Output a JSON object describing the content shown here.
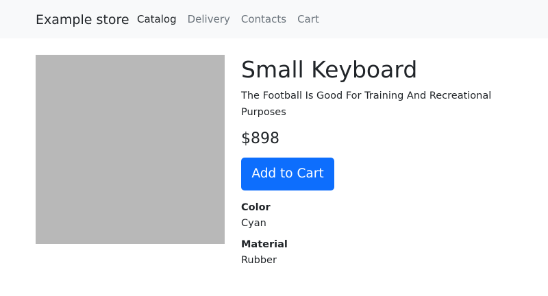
{
  "navbar": {
    "brand": "Example store",
    "links": [
      {
        "label": "Catalog",
        "active": true
      },
      {
        "label": "Delivery",
        "active": false
      },
      {
        "label": "Contacts",
        "active": false
      },
      {
        "label": "Cart",
        "active": false
      }
    ]
  },
  "product": {
    "title": "Small Keyboard",
    "description": "The Football Is Good For Training And Recreational Purposes",
    "price": "$898",
    "add_to_cart_label": "Add to Cart",
    "image_color": "#b8b8b8",
    "attributes": [
      {
        "name": "Color",
        "value": "Cyan"
      },
      {
        "name": "Material",
        "value": "Rubber"
      }
    ]
  },
  "colors": {
    "accent": "#0d6efd",
    "navbar_bg": "#f8f9fa"
  }
}
